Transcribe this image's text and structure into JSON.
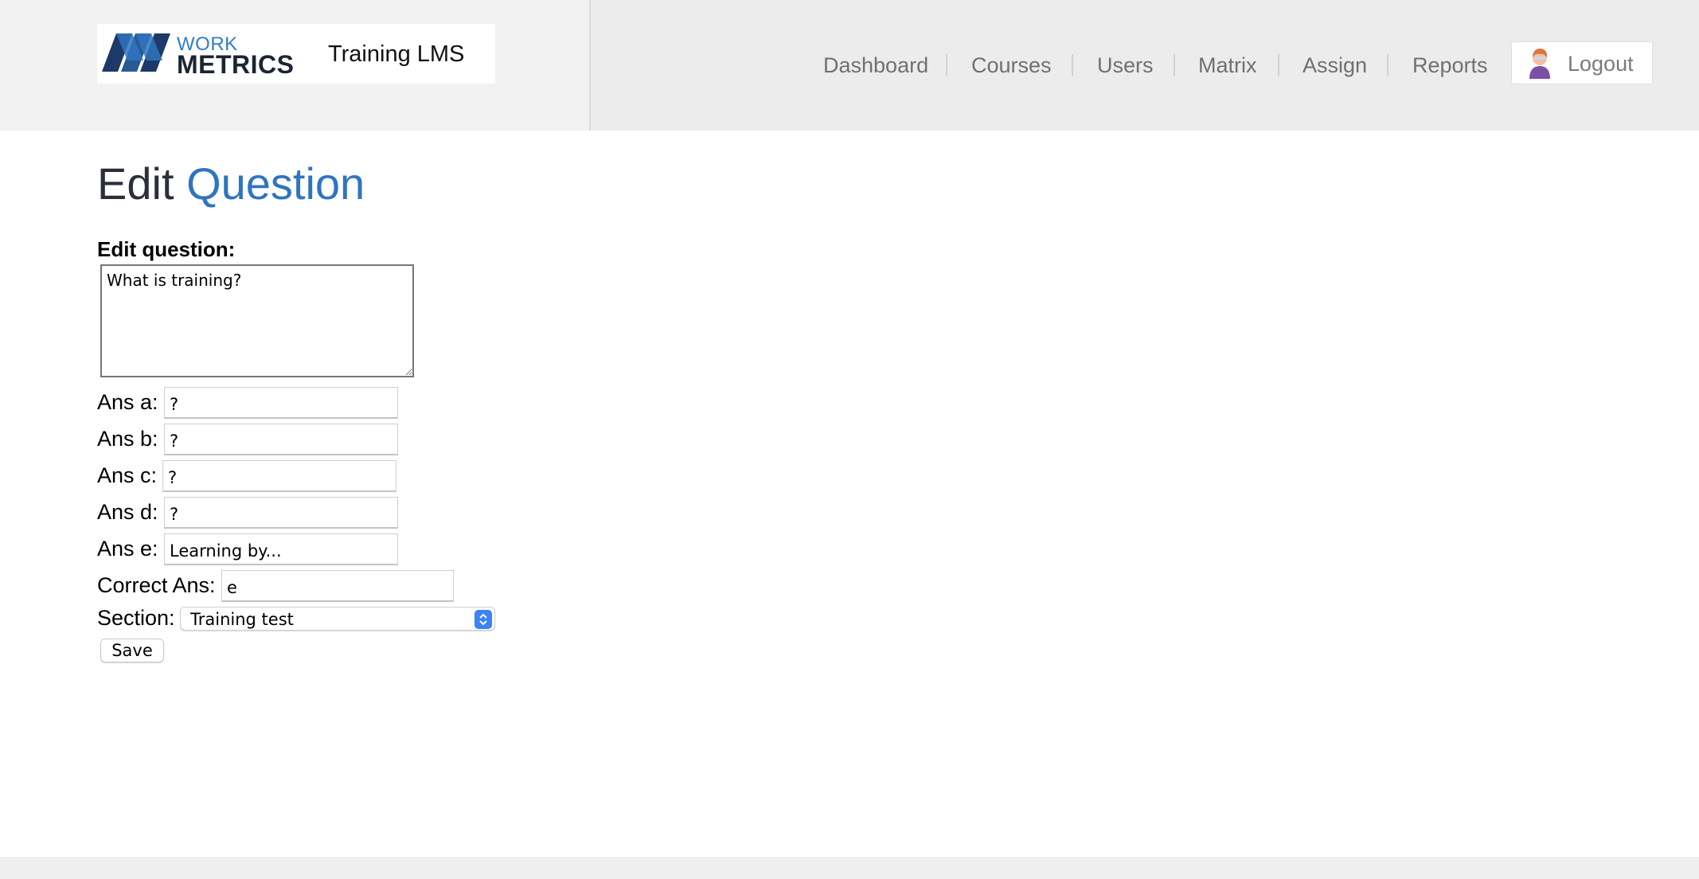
{
  "header": {
    "brand_top": "WORK",
    "brand_bottom": "METRICS",
    "product_name": "Training LMS",
    "nav": [
      "Dashboard",
      "Courses",
      "Users",
      "Matrix",
      "Assign",
      "Reports"
    ],
    "logout_label": "Logout"
  },
  "page": {
    "title_main": "Edit",
    "title_accent": "Question"
  },
  "form": {
    "question_label": "Edit question:",
    "question_value": "What is training?",
    "answers": [
      {
        "label": "Ans a:",
        "value": "?"
      },
      {
        "label": "Ans b:",
        "value": "?"
      },
      {
        "label": "Ans c:",
        "value": "?"
      },
      {
        "label": "Ans d:",
        "value": "?"
      },
      {
        "label": "Ans e:",
        "value": "Learning by..."
      }
    ],
    "correct_label": "Correct Ans:",
    "correct_value": "e",
    "section_label": "Section:",
    "section_value": "Training test",
    "save_label": "Save"
  },
  "colors": {
    "accent": "#2f74c0",
    "header_bg": "#ececec",
    "select_arrow": "#3b82f6"
  },
  "icons": [
    "workmetrics-logo-icon",
    "user-avatar-icon",
    "select-updown-icon"
  ]
}
